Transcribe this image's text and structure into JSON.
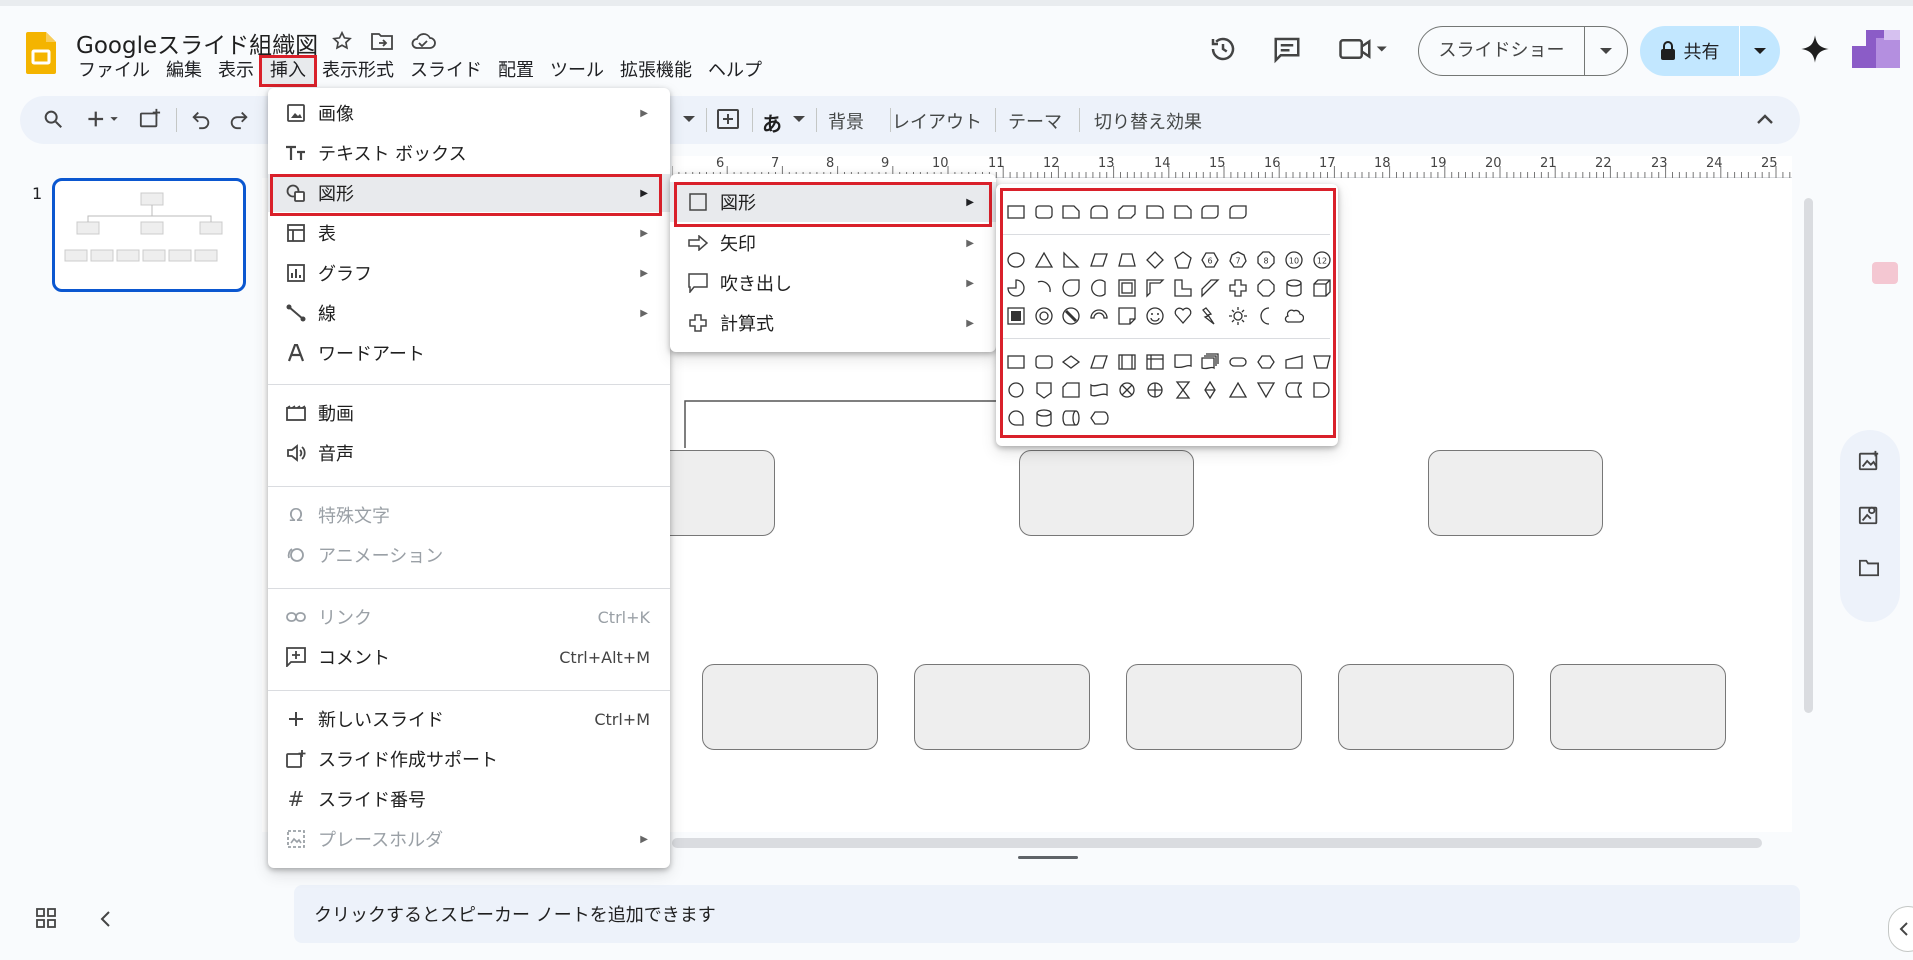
{
  "doc_title": "Googleスライド組織図",
  "menubar": [
    "ファイル",
    "編集",
    "表示",
    "挿入",
    "表示形式",
    "スライド",
    "配置",
    "ツール",
    "拡張機能",
    "ヘルプ"
  ],
  "menubar_selected": "挿入",
  "header": {
    "slideshow_label": "スライドショー",
    "share_label": "共有"
  },
  "toolbar": {
    "aa_label": "あ",
    "background": "背景",
    "layout": "レイアウト",
    "theme": "テーマ",
    "transition": "切り替え効果"
  },
  "ruler_numbers": [
    "6",
    "7",
    "8",
    "9",
    "10",
    "11",
    "12",
    "13",
    "14",
    "15",
    "16",
    "17",
    "18",
    "19",
    "20",
    "21",
    "22",
    "23",
    "24",
    "25"
  ],
  "slide_panel": {
    "slide_number": "1"
  },
  "notes_placeholder": "クリックするとスピーカー ノートを追加できます",
  "insert_menu": {
    "image": "画像",
    "textbox": "テキスト ボックス",
    "shape": "図形",
    "table": "表",
    "chart": "グラフ",
    "line": "線",
    "wordart": "ワードアート",
    "video": "動画",
    "audio": "音声",
    "special_chars": "特殊文字",
    "animation": "アニメーション",
    "link": "リンク",
    "link_shortcut": "Ctrl+K",
    "comment": "コメント",
    "comment_shortcut": "Ctrl+Alt+M",
    "new_slide": "新しいスライド",
    "new_slide_shortcut": "Ctrl+M",
    "slide_assist": "スライド作成サポート",
    "slide_number": "スライド番号",
    "placeholder": "プレースホルダ"
  },
  "shape_menu": {
    "shapes": "図形",
    "arrows": "矢印",
    "callouts": "吹き出し",
    "equation": "計算式"
  },
  "shapes_grid": {
    "hexagon_numbers": [
      "6",
      "7",
      "8",
      "10",
      "12"
    ]
  },
  "colors": {
    "accent_blue": "#0b57d0",
    "share_bg": "#c2e7ff",
    "highlight_red": "#d9202a",
    "logo_yellow": "#f4b400"
  },
  "icons": [
    "search-icon",
    "add-icon",
    "new-slide-icon",
    "undo-icon",
    "redo-icon",
    "history-icon",
    "comment-icon",
    "video-icon",
    "star-icon",
    "move-icon",
    "cloud-icon",
    "lock-icon",
    "gemini-icon"
  ]
}
